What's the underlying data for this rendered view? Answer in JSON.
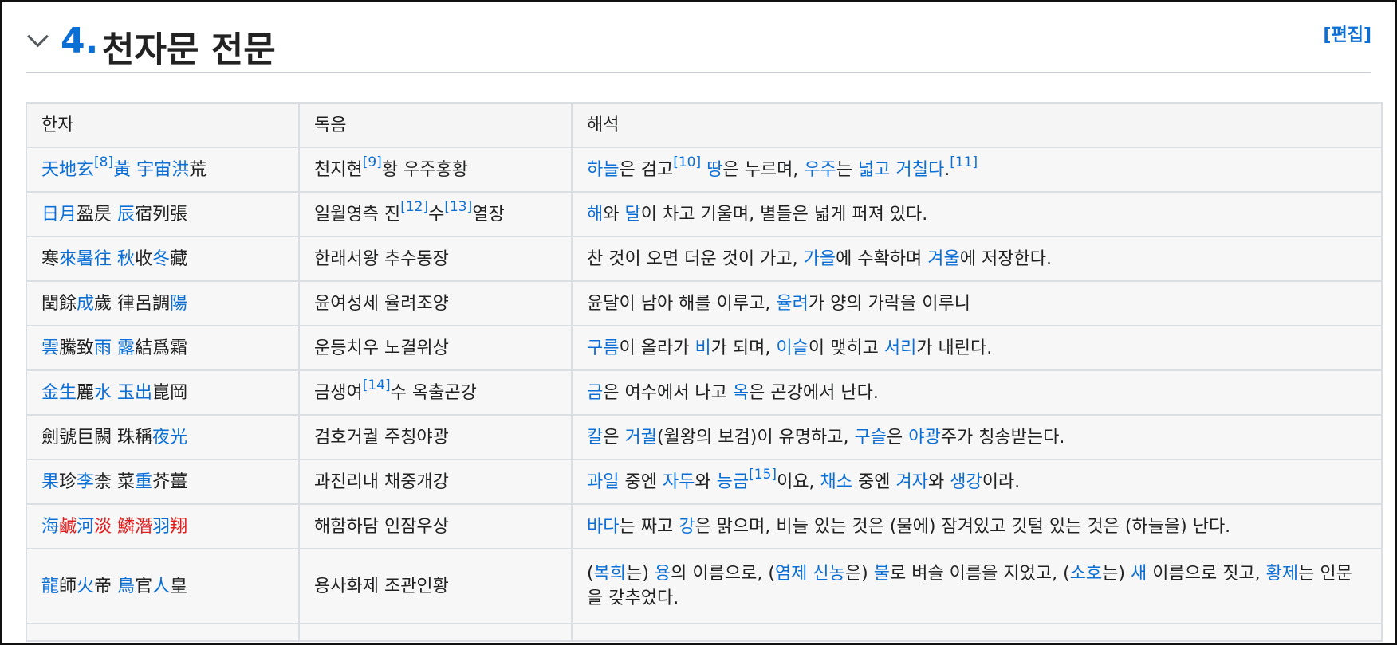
{
  "section": {
    "number": "4.",
    "title": "천자문 전문",
    "edit_label": "[편집]"
  },
  "table": {
    "headers": [
      "한자",
      "독음",
      "해석"
    ],
    "rows": [
      {
        "hanja": [
          {
            "t": "天地玄",
            "c": "b"
          },
          {
            "t": "[8]",
            "c": "sup"
          },
          {
            "t": "黃",
            "c": "b"
          },
          {
            "t": " "
          },
          {
            "t": "宇宙洪",
            "c": "b"
          },
          {
            "t": "荒"
          }
        ],
        "reading": [
          {
            "t": "천지현"
          },
          {
            "t": "[9]",
            "c": "sup"
          },
          {
            "t": "황 우주홍황"
          }
        ],
        "meaning": [
          {
            "t": "하늘",
            "c": "b"
          },
          {
            "t": "은 검고"
          },
          {
            "t": "[10]",
            "c": "sup"
          },
          {
            "t": " "
          },
          {
            "t": "땅",
            "c": "b"
          },
          {
            "t": "은 누르며, "
          },
          {
            "t": "우주",
            "c": "b"
          },
          {
            "t": "는 "
          },
          {
            "t": "넓고",
            "c": "b"
          },
          {
            "t": " "
          },
          {
            "t": "거칠다",
            "c": "b"
          },
          {
            "t": "."
          },
          {
            "t": "[11]",
            "c": "sup"
          }
        ]
      },
      {
        "hanja": [
          {
            "t": "日月",
            "c": "b"
          },
          {
            "t": "盈昃 "
          },
          {
            "t": "辰",
            "c": "b"
          },
          {
            "t": "宿列張"
          }
        ],
        "reading": [
          {
            "t": "일월영측 진"
          },
          {
            "t": "[12]",
            "c": "sup"
          },
          {
            "t": "수"
          },
          {
            "t": "[13]",
            "c": "sup"
          },
          {
            "t": "열장"
          }
        ],
        "meaning": [
          {
            "t": "해",
            "c": "b"
          },
          {
            "t": "와 "
          },
          {
            "t": "달",
            "c": "b"
          },
          {
            "t": "이 차고 기울며, 별들은 넓게 퍼져 있다."
          }
        ]
      },
      {
        "hanja": [
          {
            "t": "寒"
          },
          {
            "t": "來暑往",
            "c": "b"
          },
          {
            "t": " "
          },
          {
            "t": "秋",
            "c": "b"
          },
          {
            "t": "收"
          },
          {
            "t": "冬",
            "c": "b"
          },
          {
            "t": "藏"
          }
        ],
        "reading": [
          {
            "t": "한래서왕 추수동장"
          }
        ],
        "meaning": [
          {
            "t": "찬 것이 오면 더운 것이 가고, "
          },
          {
            "t": "가을",
            "c": "b"
          },
          {
            "t": "에 수확하며 "
          },
          {
            "t": "겨울",
            "c": "b"
          },
          {
            "t": "에 저장한다."
          }
        ]
      },
      {
        "hanja": [
          {
            "t": "閏餘"
          },
          {
            "t": "成",
            "c": "b"
          },
          {
            "t": "歲 律呂調"
          },
          {
            "t": "陽",
            "c": "b"
          }
        ],
        "reading": [
          {
            "t": "윤여성세 율려조양"
          }
        ],
        "meaning": [
          {
            "t": "윤달이 남아 해를 이루고, "
          },
          {
            "t": "율려",
            "c": "b"
          },
          {
            "t": "가 양의 가락을 이루니"
          }
        ]
      },
      {
        "hanja": [
          {
            "t": "雲",
            "c": "b"
          },
          {
            "t": "騰致"
          },
          {
            "t": "雨",
            "c": "b"
          },
          {
            "t": " "
          },
          {
            "t": "露",
            "c": "b"
          },
          {
            "t": "結爲霜"
          }
        ],
        "reading": [
          {
            "t": "운등치우 노결위상"
          }
        ],
        "meaning": [
          {
            "t": "구름",
            "c": "b"
          },
          {
            "t": "이 올라가 "
          },
          {
            "t": "비",
            "c": "b"
          },
          {
            "t": "가 되며, "
          },
          {
            "t": "이슬",
            "c": "b"
          },
          {
            "t": "이 맺히고 "
          },
          {
            "t": "서리",
            "c": "b"
          },
          {
            "t": "가 내린다."
          }
        ]
      },
      {
        "hanja": [
          {
            "t": "金生",
            "c": "b"
          },
          {
            "t": "麗"
          },
          {
            "t": "水",
            "c": "b"
          },
          {
            "t": " "
          },
          {
            "t": "玉出",
            "c": "b"
          },
          {
            "t": "崑岡"
          }
        ],
        "reading": [
          {
            "t": "금생여"
          },
          {
            "t": "[14]",
            "c": "sup"
          },
          {
            "t": "수 옥출곤강"
          }
        ],
        "meaning": [
          {
            "t": "금",
            "c": "b"
          },
          {
            "t": "은 여수에서 나고 "
          },
          {
            "t": "옥",
            "c": "b"
          },
          {
            "t": "은 곤강에서 난다."
          }
        ]
      },
      {
        "hanja": [
          {
            "t": "劍號巨闕 珠稱"
          },
          {
            "t": "夜光",
            "c": "b"
          }
        ],
        "reading": [
          {
            "t": "검호거궐 주칭야광"
          }
        ],
        "meaning": [
          {
            "t": "칼",
            "c": "b"
          },
          {
            "t": "은 "
          },
          {
            "t": "거궐",
            "c": "b"
          },
          {
            "t": "(월왕의 보검)이 유명하고, "
          },
          {
            "t": "구슬",
            "c": "b"
          },
          {
            "t": "은 "
          },
          {
            "t": "야광",
            "c": "b"
          },
          {
            "t": "주가 칭송받는다."
          }
        ]
      },
      {
        "hanja": [
          {
            "t": "果",
            "c": "b"
          },
          {
            "t": "珍"
          },
          {
            "t": "李",
            "c": "b"
          },
          {
            "t": "柰 菜"
          },
          {
            "t": "重",
            "c": "b"
          },
          {
            "t": "芥薑"
          }
        ],
        "reading": [
          {
            "t": "과진리내 채중개강"
          }
        ],
        "meaning": [
          {
            "t": "과일",
            "c": "b"
          },
          {
            "t": " 중엔 "
          },
          {
            "t": "자두",
            "c": "b"
          },
          {
            "t": "와 "
          },
          {
            "t": "능금",
            "c": "b"
          },
          {
            "t": "[15]",
            "c": "sup"
          },
          {
            "t": "이요, "
          },
          {
            "t": "채소",
            "c": "b"
          },
          {
            "t": " 중엔 "
          },
          {
            "t": "겨자",
            "c": "b"
          },
          {
            "t": "와 "
          },
          {
            "t": "생강",
            "c": "b"
          },
          {
            "t": "이라."
          }
        ]
      },
      {
        "hanja": [
          {
            "t": "海",
            "c": "b"
          },
          {
            "t": "鹹",
            "c": "r"
          },
          {
            "t": "河",
            "c": "b"
          },
          {
            "t": "淡",
            "c": "r"
          },
          {
            "t": " "
          },
          {
            "t": "鱗潛",
            "c": "r"
          },
          {
            "t": "羽",
            "c": "b"
          },
          {
            "t": "翔",
            "c": "r"
          }
        ],
        "reading": [
          {
            "t": "해함하담 인잠우상"
          }
        ],
        "meaning": [
          {
            "t": "바다",
            "c": "b"
          },
          {
            "t": "는 짜고 "
          },
          {
            "t": "강",
            "c": "b"
          },
          {
            "t": "은 맑으며, 비늘 있는 것은 (물에) 잠겨있고 깃털 있는 것은 (하늘을) 난다."
          }
        ]
      },
      {
        "tall": true,
        "hanja": [
          {
            "t": "龍",
            "c": "b"
          },
          {
            "t": "師"
          },
          {
            "t": "火",
            "c": "b"
          },
          {
            "t": "帝 "
          },
          {
            "t": "鳥",
            "c": "b"
          },
          {
            "t": "官"
          },
          {
            "t": "人",
            "c": "b"
          },
          {
            "t": "皇"
          }
        ],
        "reading": [
          {
            "t": "용사화제 조관인황"
          }
        ],
        "meaning": [
          {
            "t": "("
          },
          {
            "t": "복희",
            "c": "b"
          },
          {
            "t": "는) "
          },
          {
            "t": "용",
            "c": "b"
          },
          {
            "t": "의 이름으로, ("
          },
          {
            "t": "염제",
            "c": "b"
          },
          {
            "t": " "
          },
          {
            "t": "신농",
            "c": "b"
          },
          {
            "t": "은) "
          },
          {
            "t": "불",
            "c": "b"
          },
          {
            "t": "로 벼슬 이름을 지었고, ("
          },
          {
            "t": "소호",
            "c": "b"
          },
          {
            "t": "는) "
          },
          {
            "t": "새",
            "c": "b"
          },
          {
            "t": " 이름으로 짓고, "
          },
          {
            "t": "황제",
            "c": "b"
          },
          {
            "t": "는 인문을 갖추었다."
          }
        ]
      }
    ]
  }
}
